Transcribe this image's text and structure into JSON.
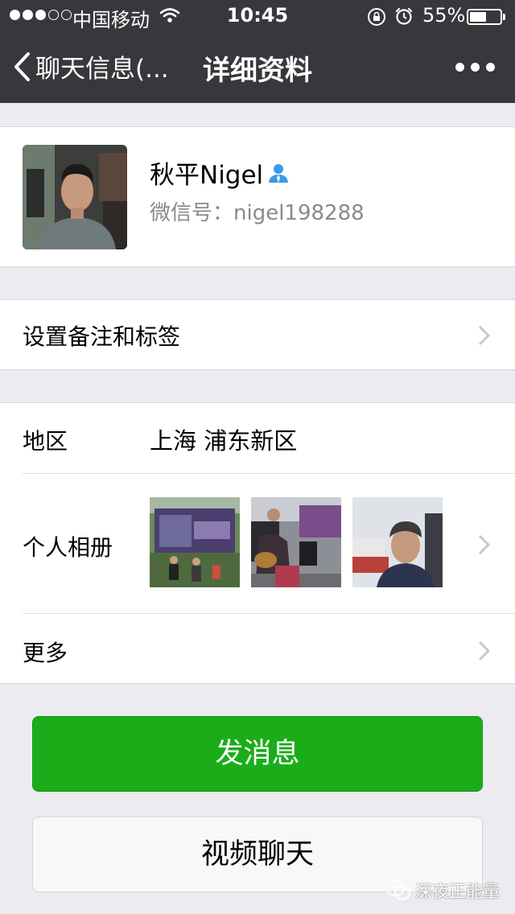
{
  "status_bar": {
    "carrier": "中国移动",
    "time": "10:45",
    "battery_percent_text": "55%",
    "battery_level": 0.55,
    "signal_bars_filled": 3,
    "signal_bars_total": 5
  },
  "nav": {
    "back_label": "聊天信息(...",
    "title": "详细资料",
    "more_icon": "ellipsis-icon"
  },
  "profile": {
    "name": "秋平Nigel",
    "wechat_id_text": "微信号：nigel198288",
    "badge_icon": "person-icon"
  },
  "remark_row": {
    "label": "设置备注和标签"
  },
  "region_row": {
    "label": "地区",
    "value": "上海 浦东新区"
  },
  "album_row": {
    "label": "个人相册",
    "photos": [
      "photo-1",
      "photo-2",
      "photo-3"
    ]
  },
  "more_row": {
    "label": "更多"
  },
  "buttons": {
    "send_message": "发消息",
    "video_chat": "视频聊天"
  },
  "watermark": {
    "text": "深夜正能量"
  },
  "colors": {
    "nav_bg": "#38383c",
    "page_bg": "#ebebf0",
    "primary_green": "#1aad19",
    "secondary_text": "#8a8a8a",
    "badge_blue": "#3b9ae8"
  }
}
